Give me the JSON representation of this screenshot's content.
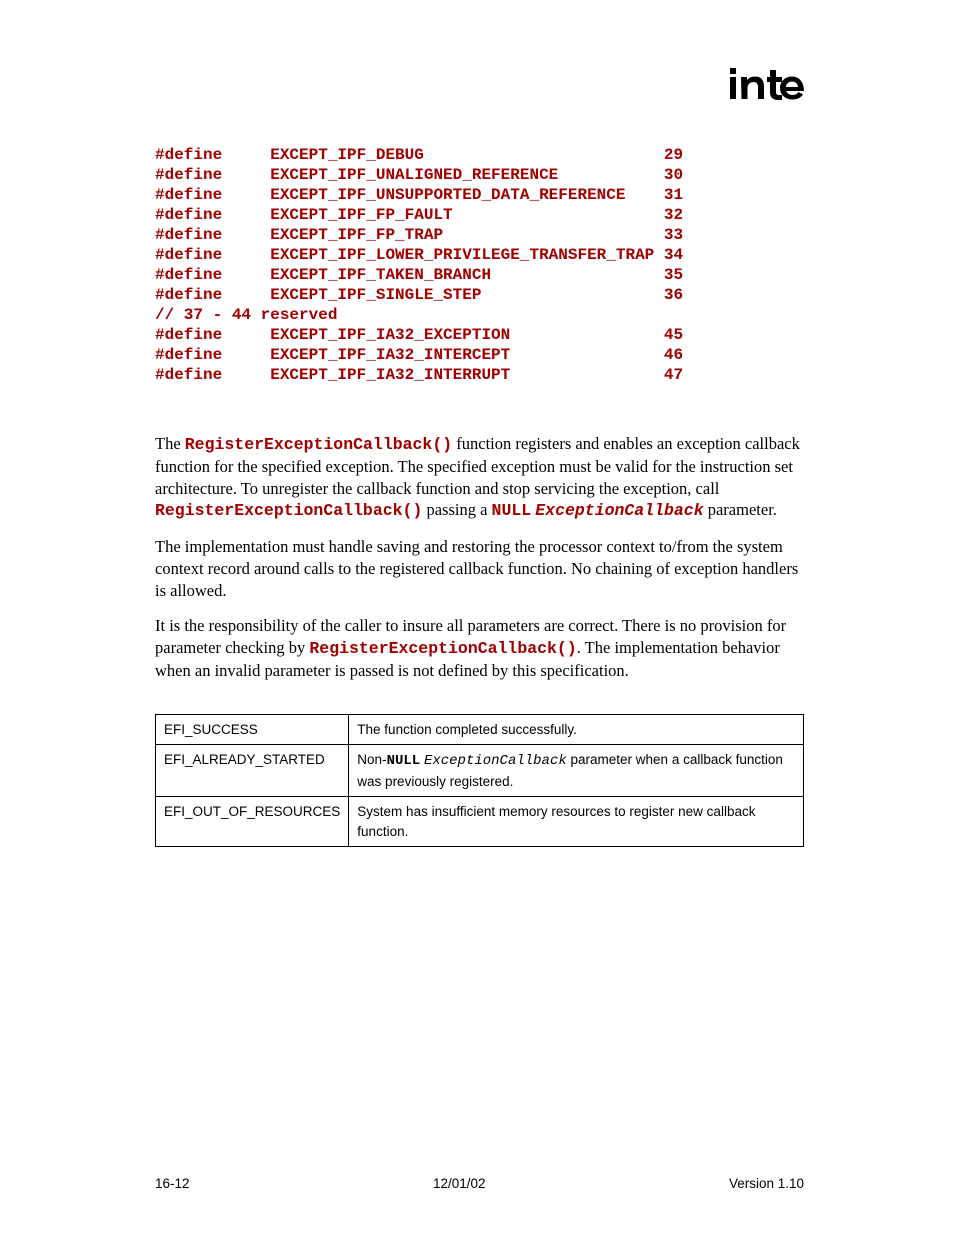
{
  "logo_alt": "intel",
  "defines": [
    {
      "kw": "#define",
      "name": "EXCEPT_IPF_DEBUG",
      "val": "29"
    },
    {
      "kw": "#define",
      "name": "EXCEPT_IPF_UNALIGNED_REFERENCE",
      "val": "30"
    },
    {
      "kw": "#define",
      "name": "EXCEPT_IPF_UNSUPPORTED_DATA_REFERENCE",
      "val": "31"
    },
    {
      "kw": "#define",
      "name": "EXCEPT_IPF_FP_FAULT",
      "val": "32"
    },
    {
      "kw": "#define",
      "name": "EXCEPT_IPF_FP_TRAP",
      "val": "33"
    },
    {
      "kw": "#define",
      "name": "EXCEPT_IPF_LOWER_PRIVILEGE_TRANSFER_TRAP",
      "val": "34"
    },
    {
      "kw": "#define",
      "name": "EXCEPT_IPF_TAKEN_BRANCH",
      "val": "35"
    },
    {
      "kw": "#define",
      "name": "EXCEPT_IPF_SINGLE_STEP",
      "val": "36"
    }
  ],
  "comment": "// 37 - 44 reserved",
  "defines2": [
    {
      "kw": "#define",
      "name": "EXCEPT_IPF_IA32_EXCEPTION",
      "val": "45"
    },
    {
      "kw": "#define",
      "name": "EXCEPT_IPF_IA32_INTERCEPT",
      "val": "46"
    },
    {
      "kw": "#define",
      "name": "EXCEPT_IPF_IA32_INTERRUPT",
      "val": "47"
    }
  ],
  "p1": {
    "t1": "The ",
    "c1": "RegisterExceptionCallback()",
    "t2": " function registers and enables an exception callback function for the specified exception.  The specified exception must be valid for the instruction set architecture.  To unregister the callback function and stop servicing the exception, call ",
    "c2": "RegisterExceptionCallback()",
    "t3": " passing a ",
    "c3": "NULL",
    "sp": " ",
    "c4": "ExceptionCallback",
    "t4": " parameter."
  },
  "p2": "The implementation must handle saving and restoring the processor context to/from the system context record around calls to the registered callback function.  No chaining of exception handlers is allowed.",
  "p3": {
    "t1": "It is the responsibility of the caller to insure all parameters are correct.  There is no provision for parameter checking by ",
    "c1": "RegisterExceptionCallback()",
    "t2": ".  The implementation behavior when an invalid parameter is passed is not defined by this specification."
  },
  "table": {
    "r0": {
      "key": "EFI_SUCCESS",
      "val": "The function completed successfully."
    },
    "r1": {
      "key": "EFI_ALREADY_STARTED",
      "t1": "Non-",
      "c1": "NULL",
      "sp": " ",
      "c2": "ExceptionCallback",
      "t2": " parameter when a callback function was previously registered."
    },
    "r2": {
      "key": "EFI_OUT_OF_RESOURCES",
      "val": "System has insufficient memory resources to register new callback function."
    }
  },
  "footer": {
    "left": "16-12",
    "center": "12/01/02",
    "right": "Version 1.10"
  }
}
